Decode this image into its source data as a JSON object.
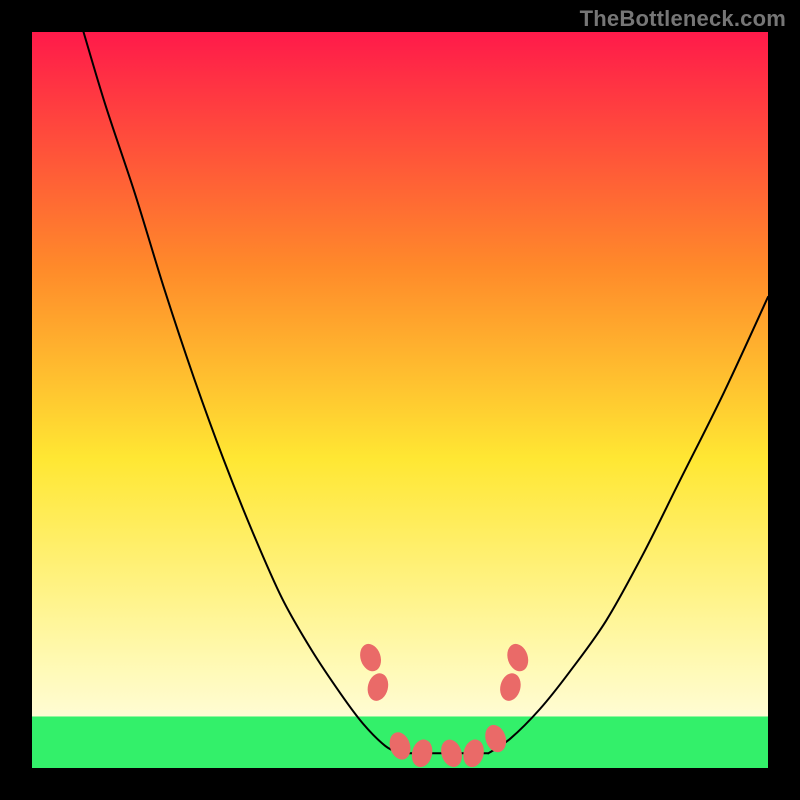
{
  "watermark": "TheBottleneck.com",
  "chart_data": {
    "type": "line",
    "title": "",
    "xlabel": "",
    "ylabel": "",
    "xlim": [
      0,
      100
    ],
    "ylim": [
      0,
      100
    ],
    "grid": false,
    "gradient_colors": {
      "top": "#ff1a4a",
      "mid_upper": "#ff8a2a",
      "mid": "#ffe733",
      "mid_lower": "#fff9b0",
      "bottom": "#33f06a"
    },
    "green_band_y_range": [
      93,
      100
    ],
    "curve_color": "#000000",
    "marker_color": "#ea6a68",
    "series": [
      {
        "name": "left-curve",
        "x": [
          7,
          10,
          14,
          18,
          22,
          26,
          30,
          34,
          38,
          42,
          45,
          48,
          50
        ],
        "y": [
          0,
          10,
          22,
          35,
          47,
          58,
          68,
          77,
          84,
          90,
          94,
          97,
          98
        ]
      },
      {
        "name": "right-curve",
        "x": [
          62,
          65,
          69,
          73,
          78,
          83,
          88,
          94,
          100
        ],
        "y": [
          98,
          96,
          92,
          87,
          80,
          71,
          61,
          49,
          36
        ]
      }
    ],
    "flat_bottom": {
      "x_range": [
        50,
        62
      ],
      "y": 98
    },
    "markers": [
      {
        "x": 46,
        "y": 85
      },
      {
        "x": 47,
        "y": 89
      },
      {
        "x": 50,
        "y": 97
      },
      {
        "x": 53,
        "y": 98
      },
      {
        "x": 57,
        "y": 98
      },
      {
        "x": 60,
        "y": 98
      },
      {
        "x": 63,
        "y": 96
      },
      {
        "x": 65,
        "y": 89
      },
      {
        "x": 66,
        "y": 85
      }
    ]
  }
}
